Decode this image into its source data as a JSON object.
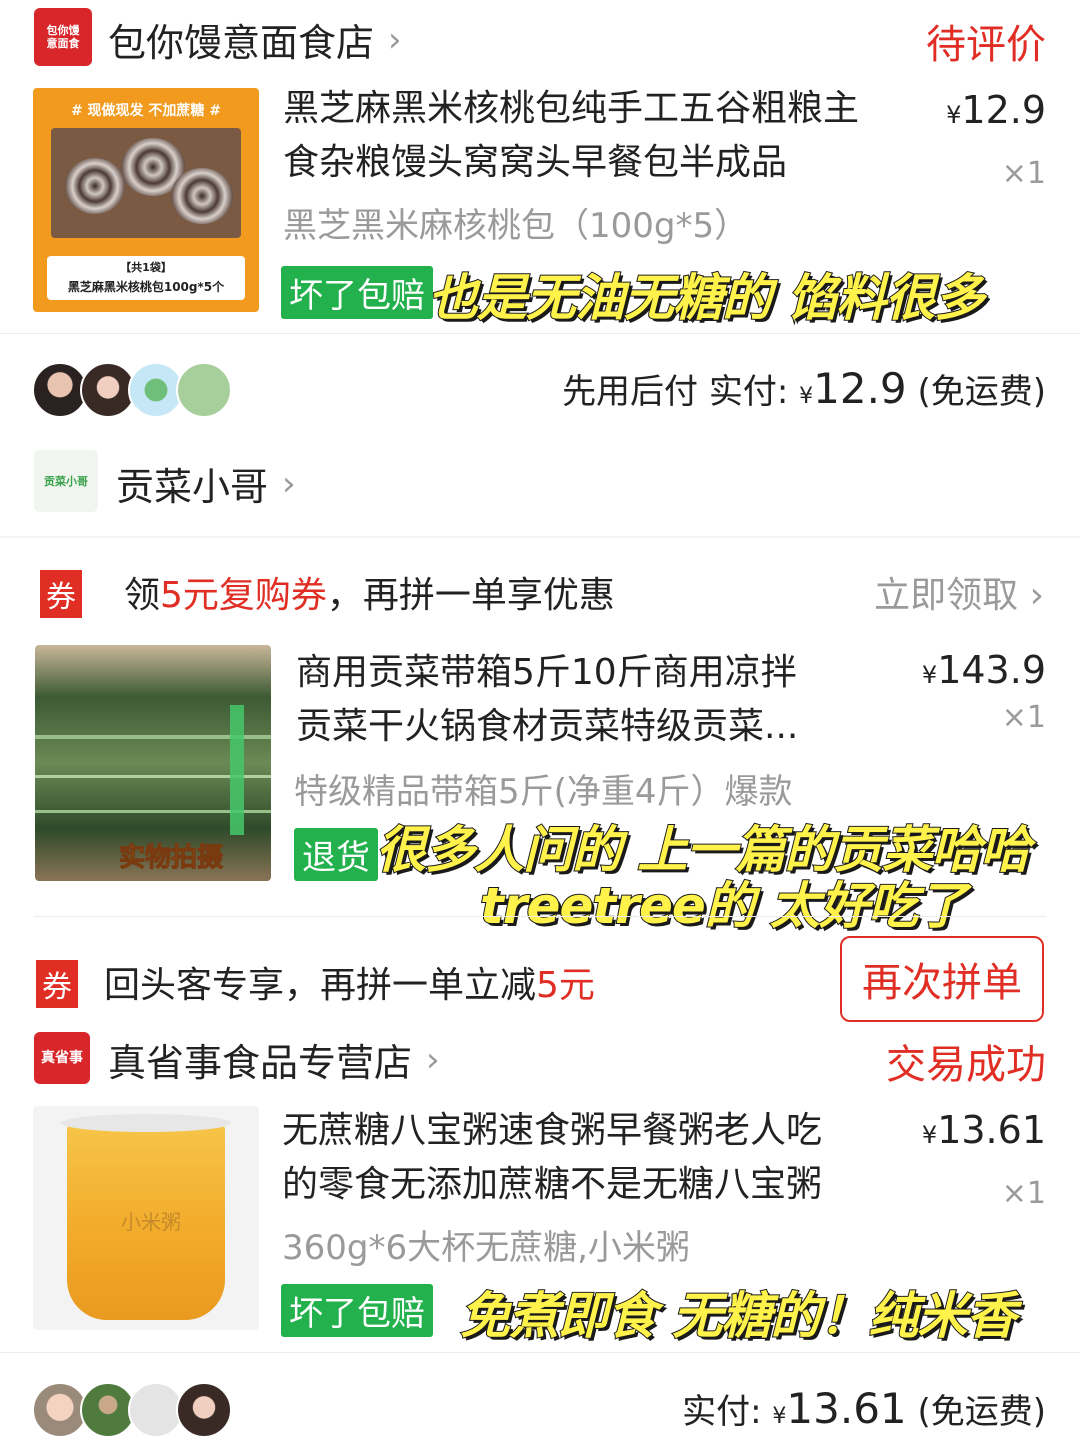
{
  "order1": {
    "shop_logo_text": "包你馒意面食",
    "shop_name": "包你馒意面食店",
    "status": "待评价",
    "product": {
      "image_banner": "# 现做现发 不加蔗糖 #",
      "image_bag": "【共1袋】",
      "image_caption": "黑芝麻黑米核桃包100g*5个",
      "title_line1": "黑芝麻黑米核桃包纯手工五谷粗粮主",
      "title_line2": "食杂粮馒头窝窝头早餐包半成品",
      "sku": "黑芝黑米麻核桃包（100g*5）",
      "price": "12.9",
      "qty": "×1",
      "tag": "坏了包赔"
    },
    "caption": "也是无油无糖的 馅料很多",
    "pay_label": "先用后付 实付:",
    "pay_amount": "12.9",
    "pay_note": "(免运费)"
  },
  "order2": {
    "shop_logo_text": "贡菜小哥",
    "shop_name": "贡菜小哥",
    "coupon_prefix": "领",
    "coupon_highlight": "5元复购券",
    "coupon_suffix": "，再拼一单享优惠",
    "coupon_action": "立即领取",
    "product": {
      "image_caption": "实物拍摄",
      "title_line1": "商用贡菜带箱5斤10斤商用凉拌",
      "title_line2": "贡菜干火锅食材贡菜特级贡菜...",
      "sku": "特级精品带箱5斤(净重4斤）爆款",
      "price": "143.9",
      "qty": "×1",
      "tag": "退货"
    },
    "caption_line1": "很多人问的 上一篇的贡菜哈哈",
    "caption_line2": "treetree的 太好吃了",
    "promo_prefix": "回头客专享，再拼一单立减",
    "promo_highlight": "5元",
    "reorder_button": "再次拼单"
  },
  "order3": {
    "shop_logo_text": "真省事",
    "shop_name": "真省事食品专营店",
    "status": "交易成功",
    "product": {
      "image_caption": "小米粥",
      "title_line1": "无蔗糖八宝粥速食粥早餐粥老人吃",
      "title_line2": "的零食无添加蔗糖不是无糖八宝粥",
      "sku": "360g*6大杯无蔗糖,小米粥",
      "price": "13.61",
      "qty": "×1",
      "tag": "坏了包赔"
    },
    "caption": "免煮即食 无糖的！纯米香",
    "pay_label": "实付:",
    "pay_amount": "13.61",
    "pay_note": "(免运费)"
  },
  "coupon_badge": "券",
  "currency": "¥",
  "colors": {
    "accent_red": "#e02e24",
    "tag_green": "#22b14c",
    "caption_yellow": "#fff24a"
  }
}
